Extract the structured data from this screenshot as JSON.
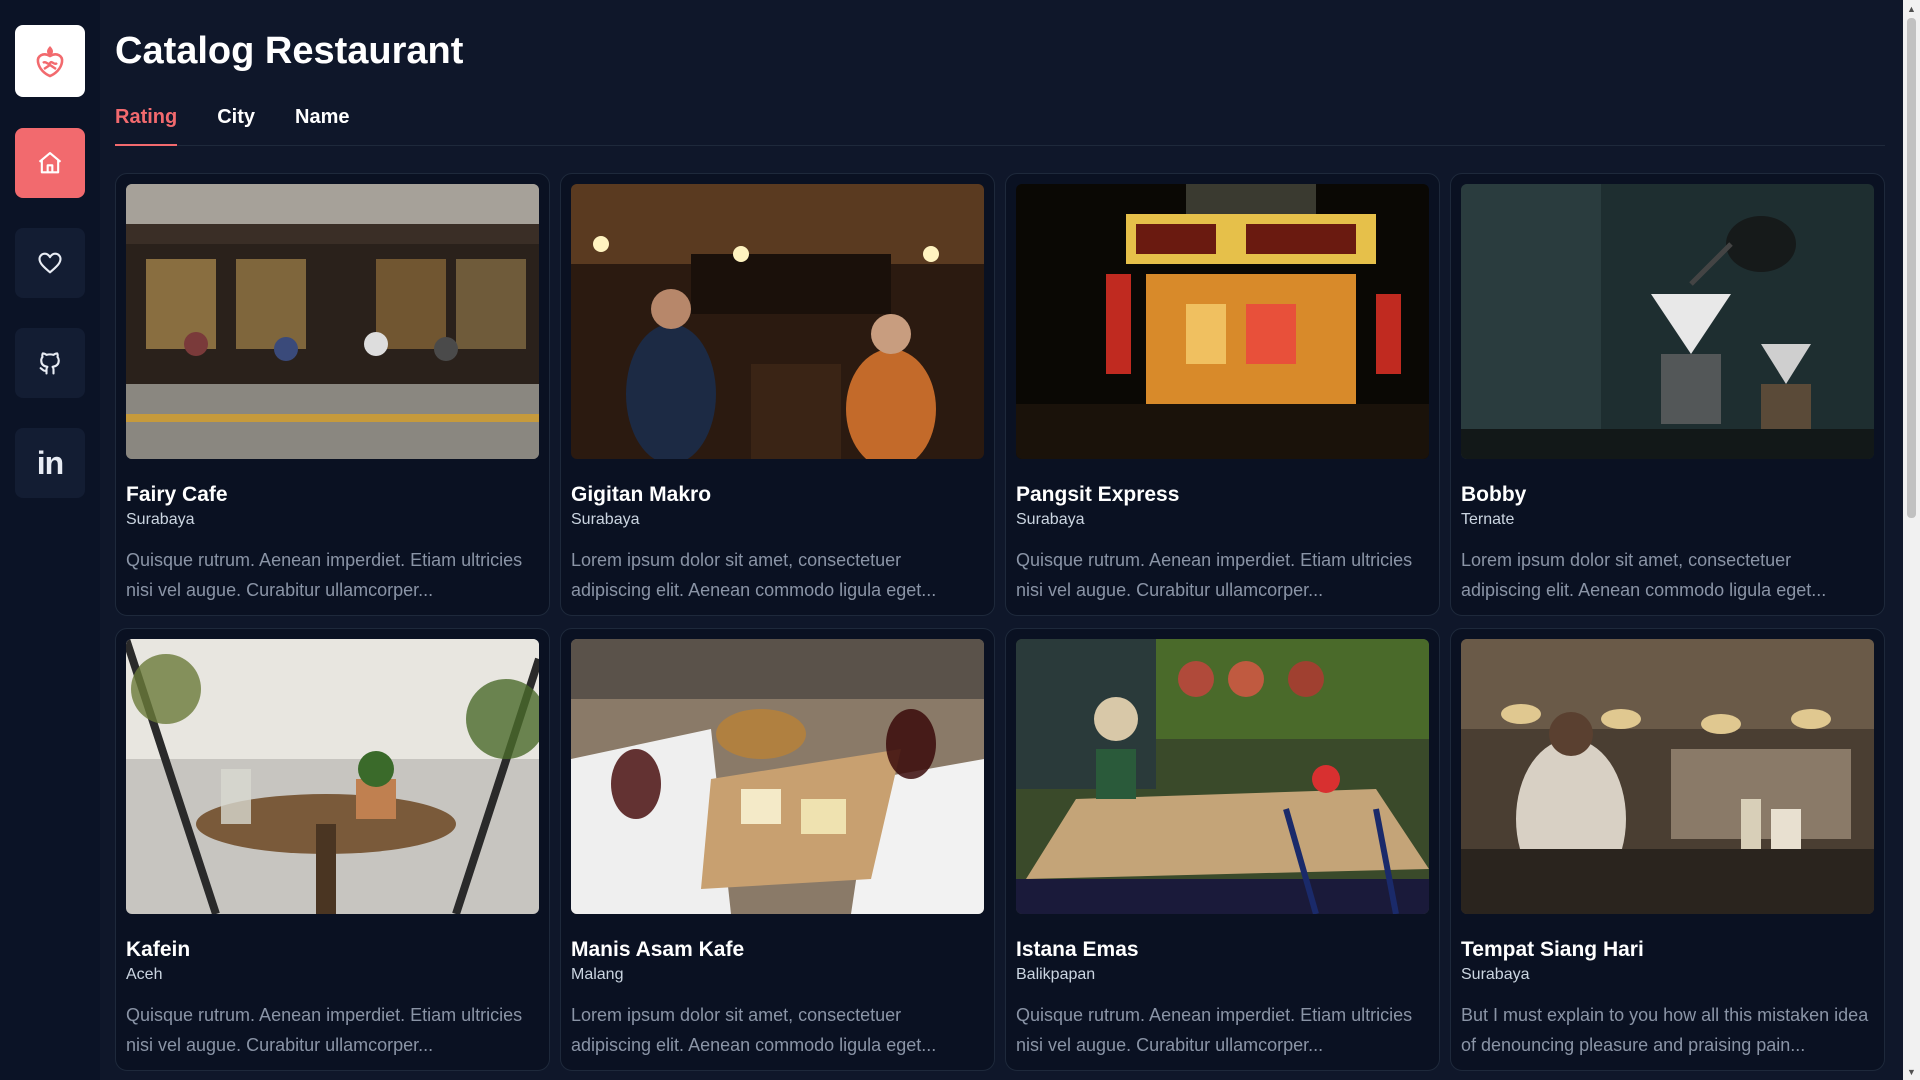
{
  "header": {
    "title": "Catalog Restaurant"
  },
  "tabs": [
    {
      "label": "Rating",
      "active": true
    },
    {
      "label": "City",
      "active": false
    },
    {
      "label": "Name",
      "active": false
    }
  ],
  "sidebar": {
    "logo_icon": "restaurant-logo-icon",
    "items": [
      {
        "icon": "home-icon",
        "active": true
      },
      {
        "icon": "heart-icon",
        "active": false
      },
      {
        "icon": "github-icon",
        "active": false
      },
      {
        "icon": "linkedin-icon",
        "label": "in",
        "active": false
      }
    ]
  },
  "restaurants": [
    {
      "name": "Fairy Cafe",
      "city": "Surabaya",
      "description": "Quisque rutrum. Aenean imperdiet. Etiam ultricies nisi vel augue. Curabitur ullamcorper..."
    },
    {
      "name": "Gigitan Makro",
      "city": "Surabaya",
      "description": "Lorem ipsum dolor sit amet, consectetuer adipiscing elit. Aenean commodo ligula eget..."
    },
    {
      "name": "Pangsit Express",
      "city": "Surabaya",
      "description": "Quisque rutrum. Aenean imperdiet. Etiam ultricies nisi vel augue. Curabitur ullamcorper..."
    },
    {
      "name": "Bobby",
      "city": "Ternate",
      "description": "Lorem ipsum dolor sit amet, consectetuer adipiscing elit. Aenean commodo ligula eget..."
    },
    {
      "name": "Kafein",
      "city": "Aceh",
      "description": "Quisque rutrum. Aenean imperdiet. Etiam ultricies nisi vel augue. Curabitur ullamcorper..."
    },
    {
      "name": "Manis Asam Kafe",
      "city": "Malang",
      "description": "Lorem ipsum dolor sit amet, consectetuer adipiscing elit. Aenean commodo ligula eget..."
    },
    {
      "name": "Istana Emas",
      "city": "Balikpapan",
      "description": "Quisque rutrum. Aenean imperdiet. Etiam ultricies nisi vel augue. Curabitur ullamcorper..."
    },
    {
      "name": "Tempat Siang Hari",
      "city": "Surabaya",
      "description": "But I must explain to you how all this mistaken idea of denouncing pleasure and praising pain..."
    }
  ],
  "colors": {
    "background": "#0f172a",
    "accent": "#f26a6e",
    "card": "#0a1122"
  }
}
